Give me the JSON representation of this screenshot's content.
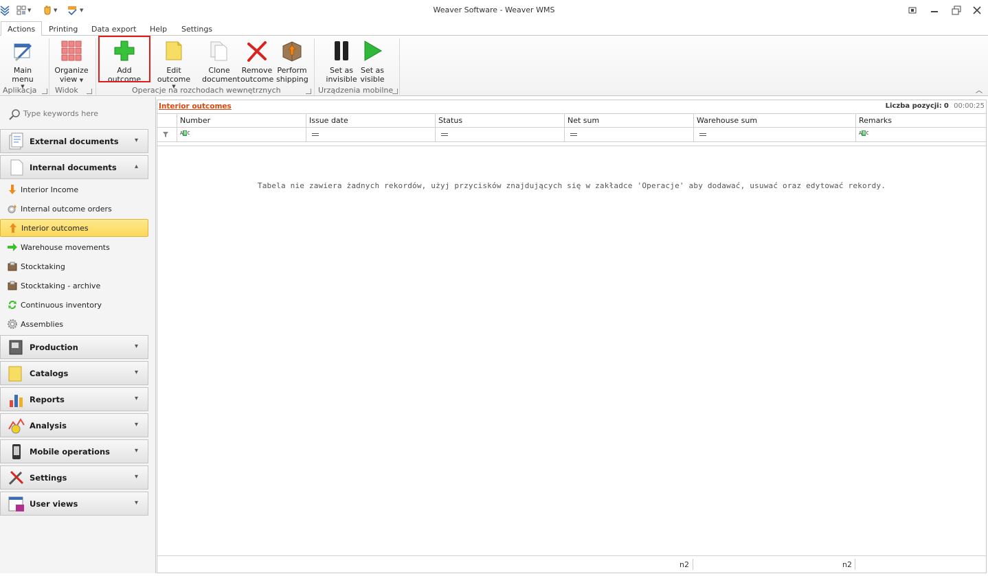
{
  "window": {
    "title": "Weaver Software - Weaver WMS"
  },
  "tabs": [
    {
      "label": "Actions",
      "active": true
    },
    {
      "label": "Printing"
    },
    {
      "label": "Data export"
    },
    {
      "label": "Help"
    },
    {
      "label": "Settings"
    }
  ],
  "ribbon": {
    "groups": [
      {
        "label": "Aplikacja"
      },
      {
        "label": "Widok"
      },
      {
        "label": "Operacje na rozchodach wewnętrznych"
      },
      {
        "label": "Urządzenia mobilne"
      }
    ],
    "buttons": {
      "main_menu": {
        "line1": "Main menu",
        "line2": ""
      },
      "organize_view": {
        "line1": "Organize",
        "line2": "view"
      },
      "add_outcome": {
        "line1": "Add outcome",
        "line2": ""
      },
      "edit_outcome": {
        "line1": "Edit outcome",
        "line2": ""
      },
      "clone_document": {
        "line1": "Clone",
        "line2": "document"
      },
      "remove_outcome": {
        "line1": "Remove",
        "line2": "outcome"
      },
      "perform_shipping": {
        "line1": "Perform",
        "line2": "shipping"
      },
      "set_invisible": {
        "line1": "Set as",
        "line2": "invisible"
      },
      "set_visible": {
        "line1": "Set as",
        "line2": "visible"
      }
    }
  },
  "sidebar": {
    "search_placeholder": "Type keywords here",
    "groups": [
      {
        "label": "External documents",
        "icon": "document-stack-icon"
      },
      {
        "label": "Internal documents",
        "icon": "blank-document-icon"
      },
      {
        "label": "Production",
        "icon": "machine-icon"
      },
      {
        "label": "Catalogs",
        "icon": "folder-icon"
      },
      {
        "label": "Reports",
        "icon": "bar-chart-icon"
      },
      {
        "label": "Analysis",
        "icon": "analysis-icon"
      },
      {
        "label": "Mobile operations",
        "icon": "mobile-device-icon"
      },
      {
        "label": "Settings",
        "icon": "tools-icon"
      },
      {
        "label": "User views",
        "icon": "user-view-icon"
      }
    ],
    "internal_items": [
      {
        "label": "Interior Income",
        "icon": "arrow-down-icon"
      },
      {
        "label": "Internal outcome orders",
        "icon": "order-gear-icon"
      },
      {
        "label": "Interior outcomes",
        "icon": "arrow-up-icon",
        "selected": true
      },
      {
        "label": "Warehouse movements",
        "icon": "arrow-right-icon"
      },
      {
        "label": "Stocktaking",
        "icon": "box-icon"
      },
      {
        "label": "Stocktaking - archive",
        "icon": "box-archive-icon"
      },
      {
        "label": "Continuous inventory",
        "icon": "refresh-icon"
      },
      {
        "label": "Assemblies",
        "icon": "gear-icon"
      }
    ]
  },
  "main": {
    "breadcrumb": "Interior outcomes",
    "count_label": "Liczba pozycji:",
    "count_value": "0",
    "time": "00:00:25",
    "columns": [
      "Number",
      "Issue date",
      "Status",
      "Net sum",
      "Warehouse sum",
      "Remarks"
    ],
    "empty_message": "Tabela nie zawiera żadnych rekordów, użyj przycisków znajdujących się w zakładce 'Operacje' aby dodawać, usuwać oraz edytować rekordy.",
    "footer_values": [
      "n2",
      "n2"
    ]
  },
  "colors": {
    "accent_red": "#e21b1b",
    "selected_bg": "#fbd85c",
    "breadcrumb": "#d9480f"
  }
}
